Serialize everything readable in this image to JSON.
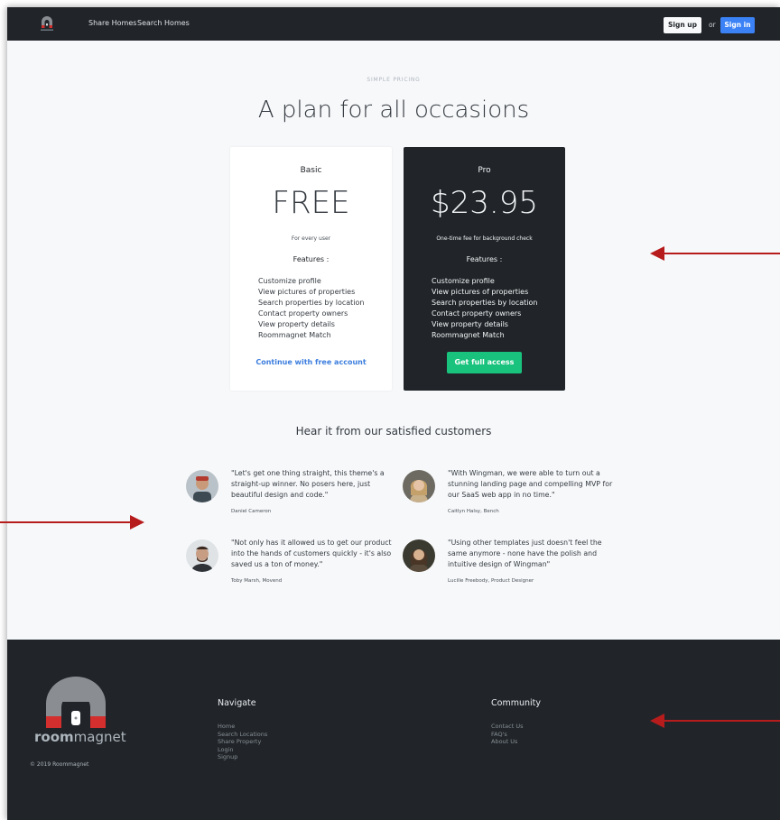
{
  "navbar": {
    "links": [
      "Share Homes",
      "Search Homes"
    ],
    "signup_label": "Sign up",
    "or_text": "or",
    "signin_label": "Sign in"
  },
  "header": {
    "eyebrow": "SIMPLE PRICING",
    "title": "A plan for all occasions"
  },
  "plans": [
    {
      "name": "Basic",
      "price": "FREE",
      "note": "For every user",
      "features_heading": "Features :",
      "features": [
        "Customize profile",
        "View pictures of properties",
        "Search properties by location",
        "Contact property owners",
        "View property details",
        "Roommagnet Match"
      ],
      "cta": "Continue with free account"
    },
    {
      "name": "Pro",
      "price": "$23.95",
      "note": "One-time fee for background check",
      "features_heading": "Features :",
      "features": [
        "Customize profile",
        "View pictures of properties",
        "Search properties by location",
        "Contact property owners",
        "View property details",
        "Roommagnet Match"
      ],
      "cta": "Get full access"
    }
  ],
  "testimonials": {
    "title": "Hear it from our satisfied customers",
    "items": [
      {
        "quote": "\"Let's get one thing straight, this theme's a straight-up winner. No posers here, just beautiful design and code.\"",
        "author": "Daniel Cameron"
      },
      {
        "quote": "\"With Wingman, we were able to turn out a stunning landing page and compelling MVP for our SaaS web app in no time.\"",
        "author": "Caitlyn Halsy, Bench"
      },
      {
        "quote": "\"Not only has it allowed us to get our product into the hands of customers quickly - it's also saved us a ton of money.\"",
        "author": "Toby Marsh, Movend"
      },
      {
        "quote": "\"Using other templates just doesn't feel the same anymore - none have the polish and intuitive design of Wingman\"",
        "author": "Lucille Freebody, Product Designer"
      }
    ]
  },
  "footer": {
    "brand_bold": "room",
    "brand_light": "magnet",
    "copyright": "© 2019 Roommagnet",
    "navigate": {
      "heading": "Navigate",
      "links": [
        "Home",
        "Search Locations",
        "Share Property",
        "Login",
        "Signup"
      ]
    },
    "community": {
      "heading": "Community",
      "links": [
        "Contact Us",
        "FAQ's",
        "About Us"
      ]
    }
  },
  "colors": {
    "dark": "#212529",
    "accent_blue": "#3b82f6",
    "accent_green": "#19c37d",
    "brand_red": "#d32f2f",
    "annotation_arrow": "#b71c1c"
  }
}
